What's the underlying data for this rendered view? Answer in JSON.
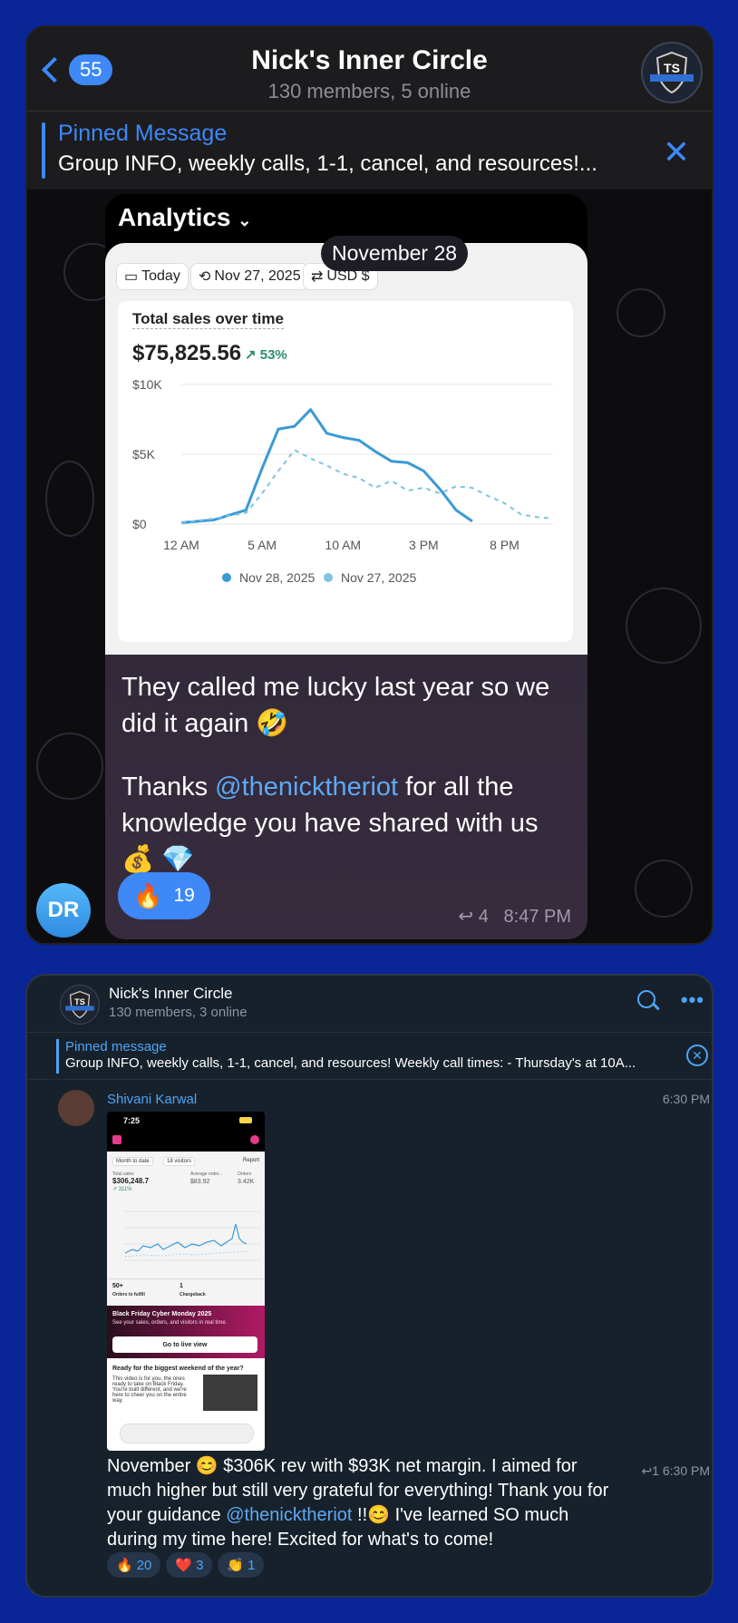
{
  "top_chat": {
    "back_count": "55",
    "title": "Nick's Inner Circle",
    "subtitle": "130 members, 5 online",
    "pinned_title": "Pinned Message",
    "pinned_text": "Group INFO, weekly calls, 1-1, cancel, and resources!...",
    "date_pill": "November 28",
    "screenshot": {
      "header": "Analytics",
      "pills": [
        "Today",
        "Nov 27, 2025",
        "USD $"
      ],
      "card_title": "Total sales over time",
      "total": "$75,825.56",
      "change": "53%"
    },
    "message_line1": "They called me lucky last year so we did it again 🤣",
    "message_thanks": "Thanks ",
    "mention": "@thenicktheriot",
    "message_rest": " for all the knowledge you have shared with us",
    "message_emojis": "💰 💎",
    "reaction_emoji": "🔥",
    "reaction_count": "19",
    "reply_count": "4",
    "time": "8:47 PM",
    "avatar_initials": "DR"
  },
  "chart_data": {
    "type": "line",
    "title": "Total sales over time",
    "y_ticks": [
      "$10K",
      "$5K",
      "$0"
    ],
    "ylim": [
      0,
      10000
    ],
    "x_ticks": [
      "12 AM",
      "5 AM",
      "10 AM",
      "3 PM",
      "8 PM"
    ],
    "x_hours": [
      0,
      2,
      4,
      5,
      6,
      7,
      8,
      9,
      10,
      11,
      12,
      13,
      14,
      15,
      16,
      17,
      18,
      19,
      20,
      21,
      22,
      23
    ],
    "series": [
      {
        "name": "Nov 28, 2025",
        "color": "#3a9ad6",
        "dashed": false,
        "values": [
          100,
          300,
          1000,
          4000,
          6800,
          7000,
          8200,
          6500,
          6200,
          6000,
          5200,
          4500,
          4400,
          3800,
          2500,
          1000,
          200,
          null,
          null,
          null,
          null,
          null
        ]
      },
      {
        "name": "Nov 27, 2025",
        "color": "#7fc4e0",
        "dashed": true,
        "values": [
          100,
          400,
          800,
          2200,
          3800,
          5300,
          4700,
          4200,
          3600,
          3300,
          2600,
          3100,
          2400,
          2600,
          2200,
          2700,
          2600,
          2000,
          1500,
          700,
          500,
          400
        ]
      }
    ],
    "legend_position": "bottom"
  },
  "bottom_chat": {
    "title": "Nick's Inner Circle",
    "subtitle": "130 members, 3 online",
    "pinned_title": "Pinned message",
    "pinned_text": "Group INFO, weekly calls, 1-1, cancel, and resources!   Weekly call times:  - Thursday's at 10A...",
    "sender": "Shivani Karwal",
    "time_top": "6:30 PM",
    "phone": {
      "status_time": "7:25",
      "filter1": "Month to date",
      "filter2": "18 visitors",
      "report": "Report",
      "total_sales_label": "Total sales",
      "total_sales": "$306,248.7",
      "total_sales_change": "311%",
      "aov_label": "Average order...",
      "aov": "$83.92",
      "orders_label": "Orders",
      "orders": "3.42K",
      "orders_fulfill": "50+",
      "orders_fulfill_label": "Orders to fulfill",
      "chargeback": "1",
      "chargeback_label": "Chargeback",
      "bf_title": "Black Friday Cyber Monday 2025",
      "bf_sub": "See your sales, orders, and visitors in real time.",
      "bf_button": "Go to live view",
      "ready_title": "Ready for the biggest weekend of the year?",
      "ready_text": "This video is for you, the ones ready to take on Black Friday. You're built different, and we're here to cheer you on the entire way."
    },
    "msg_a": "November 😊  $306K rev with $93K net margin. I aimed for much higher but still very grateful for everything! Thank you for your guidance ",
    "mention": "@thenicktheriot",
    "msg_b": " !!😊 I've learned SO much during my time here! Excited for what's to come!",
    "reply_count": "1",
    "time": "6:30 PM",
    "reactions": [
      {
        "emoji": "🔥",
        "count": "20"
      },
      {
        "emoji": "❤️",
        "count": "3"
      },
      {
        "emoji": "👏",
        "count": "1"
      }
    ]
  }
}
